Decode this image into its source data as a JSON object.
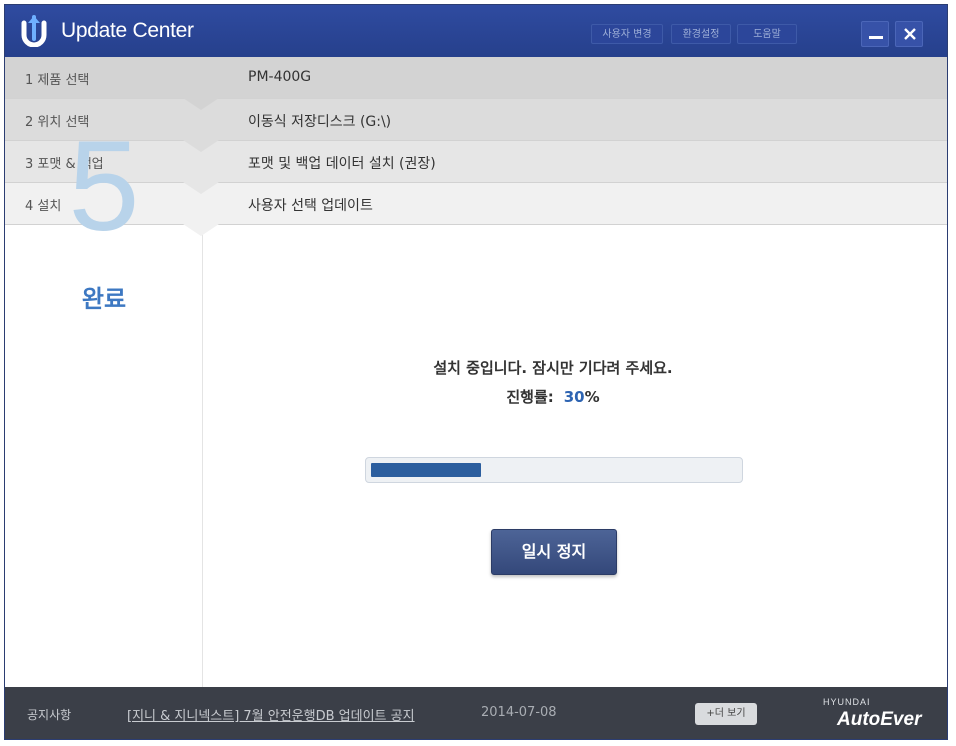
{
  "window": {
    "title": "Update Center",
    "top_buttons": [
      "사용자 변경",
      "환경설정",
      "도움말"
    ]
  },
  "steps": [
    {
      "label": "1  제품 선택",
      "value": "PM-400G"
    },
    {
      "label": "2  위치 선택",
      "value": "이동식 저장디스크 (G:\\)"
    },
    {
      "label": "3  포맷 & 백업",
      "value": "포맷 및 백업 데이터 설치 (권장)"
    },
    {
      "label": "4  설치",
      "value": "사용자 선택 업데이트"
    }
  ],
  "current_step": {
    "number": "5",
    "label": "완료"
  },
  "install": {
    "message": "설치 중입니다. 잠시만 기다려 주세요.",
    "progress_label": "진행률:",
    "progress_value": "30",
    "progress_unit": "%",
    "progress_fraction": 0.3,
    "pause_label": "일시 정지"
  },
  "footer": {
    "notice_label": "공지사항",
    "notice_text": "[지니 & 지니넥스트] 7월 안전운행DB 업데이트 공지",
    "notice_date": "2014-07-08",
    "more_label": "+더 보기",
    "brand_top": "HYUNDAI",
    "brand": "AutoEver"
  },
  "colors": {
    "titlebar": "#26408c",
    "accent": "#2e64b2",
    "big_number": "#b8d3ea",
    "footer": "#3b3f48"
  },
  "icons": {
    "logo": "update-arrow-u-logo",
    "minimize": "minimize-icon",
    "close": "close-icon"
  }
}
